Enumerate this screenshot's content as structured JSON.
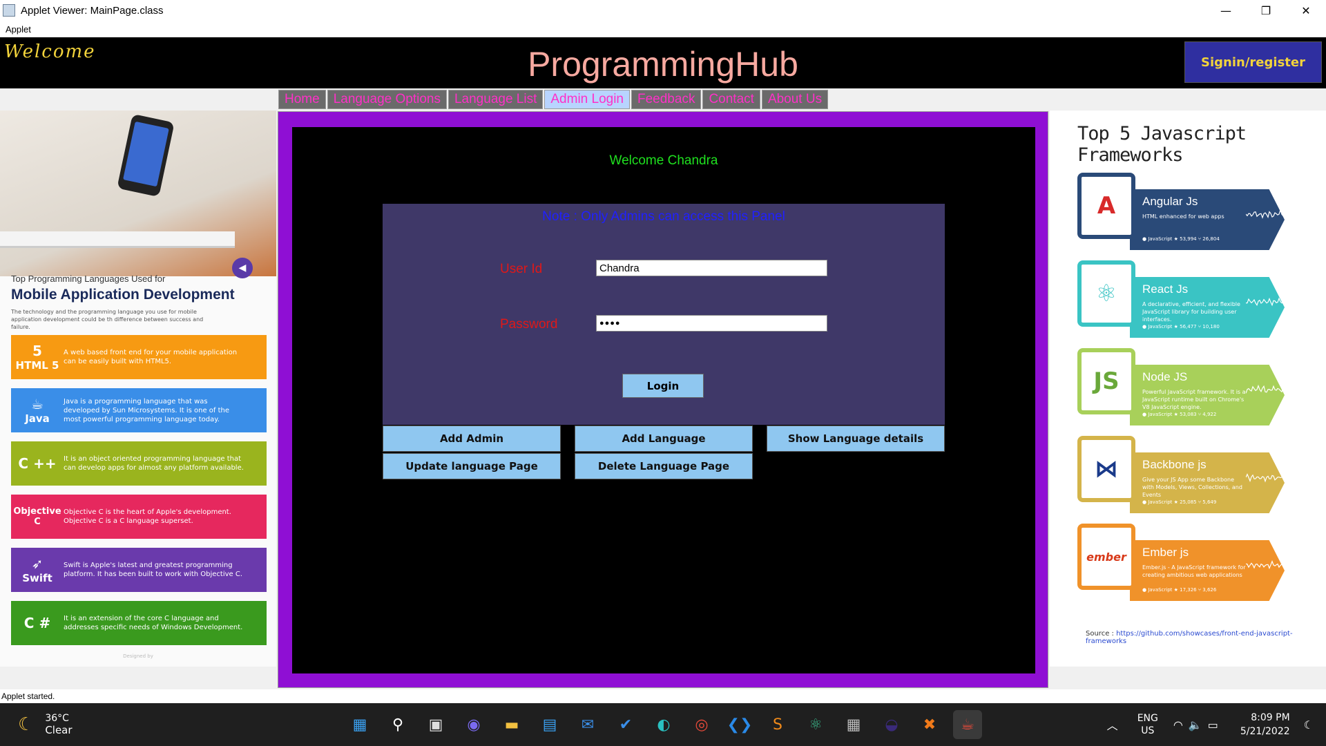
{
  "window": {
    "title": "Applet Viewer: MainPage.class",
    "menu": "Applet",
    "controls": {
      "minimize": "—",
      "restore": "❐",
      "close": "✕"
    }
  },
  "header": {
    "welcome": "Welcome",
    "brand": "ProgrammingHub",
    "signin": "Signin/register"
  },
  "tabs": [
    "Home",
    "Language Options",
    "Language List",
    "Admin Login",
    "Feedback",
    "Contact",
    "About Us"
  ],
  "active_tab": "Admin Login",
  "left_panel": {
    "subtitle": "Top Programming Languages Used for",
    "title": "Mobile Application Development",
    "description": "The technology and the programming language you use for mobile application development could be th difference between success and failure.",
    "cards": [
      {
        "name": "HTML 5",
        "icon": "html5-icon",
        "glyph": "5",
        "color": "#f79a12",
        "text": "A web based front end for your mobile application can be easily built with HTML5."
      },
      {
        "name": "Java",
        "icon": "java-icon",
        "glyph": "☕",
        "color": "#3a8ee8",
        "text": "Java is a programming language that was developed by Sun Microsystems. It is one of the most powerful programming language today."
      },
      {
        "name": "C ++",
        "icon": "cpp-icon",
        "glyph": "",
        "color": "#9ab41e",
        "text": "It is an object oriented programming language that can develop apps for almost any platform available."
      },
      {
        "name": "Objective C",
        "icon": "objc-icon",
        "glyph": "",
        "color": "#e6285e",
        "text": "Objective C is the heart of Apple's development. Objective C is a C language superset."
      },
      {
        "name": "Swift",
        "icon": "swift-icon",
        "glyph": "➶",
        "color": "#6a3aac",
        "text": "Swift is Apple's latest and greatest programming platform. It has been built to work with Objective C."
      },
      {
        "name": "C #",
        "icon": "csharp-icon",
        "glyph": "",
        "color": "#3a9a1e",
        "text": "It is an extension of the core C language and addresses specific needs of Windows Development."
      }
    ],
    "footer": "Designed by"
  },
  "admin": {
    "welcome": "Welcome Chandra",
    "note": "Note : Only Admins can access this Panel",
    "userid_label": "User Id",
    "userid_value": "Chandra",
    "password_label": "Password",
    "password_value": "●●●●",
    "login": "Login",
    "actions": [
      "Add Admin",
      "Add Language",
      "Show Language details",
      "Update language Page",
      "Delete Language Page"
    ]
  },
  "right_panel": {
    "title": "Top 5 Javascript Frameworks",
    "frameworks": [
      {
        "name": "Angular Js",
        "desc": "HTML enhanced for web apps",
        "stats": "● JavaScript   ★ 53,994   ⑂ 26,804",
        "color": "#2a4a78",
        "icon": "angular-icon",
        "glyph": "A",
        "icolor": "#d82a2a"
      },
      {
        "name": "React Js",
        "desc": "A declarative, efficient, and flexible JavaScript library for building user interfaces.",
        "stats": "● JavaScript   ★ 56,477   ⑂ 10,180",
        "color": "#3ac4c4",
        "icon": "react-icon",
        "glyph": "⚛",
        "icolor": "#3ac4c4"
      },
      {
        "name": "Node JS",
        "desc": "Powerful JavaScript framework. It is a JavaScript runtime built on Chrome's V8 JavaScript engine.",
        "stats": "● JavaScript   ★ 53,083   ⑂ 4,922",
        "color": "#a8d05a",
        "icon": "node-icon",
        "glyph": "JS",
        "icolor": "#6aa83a"
      },
      {
        "name": "Backbone js",
        "desc": "Give your JS App some Backbone with Models, Views, Collections, and Events",
        "stats": "● JavaScript   ★ 25,085   ⑂ 5,649",
        "color": "#d4b44a",
        "icon": "backbone-icon",
        "glyph": "⋈",
        "icolor": "#1a3a8a"
      },
      {
        "name": "Ember js",
        "desc": "Ember.js - A JavaScript framework for creating ambitious web applications",
        "stats": "● JavaScript   ★ 17,326   ⑂ 3,626",
        "color": "#f0922a",
        "icon": "ember-icon",
        "glyph": "ember",
        "icolor": "#d83a1a"
      }
    ],
    "source_label": "Source : ",
    "source_link": "https://github.com/showcases/front-end-javascript-frameworks"
  },
  "status": "Applet started.",
  "taskbar": {
    "temp": "36°C",
    "condition": "Clear",
    "lang1": "ENG",
    "lang2": "US",
    "time": "8:09 PM",
    "date": "5/21/2022",
    "apps": [
      {
        "icon": "windows-start-icon",
        "glyph": "▦",
        "color": "#3aa0f0"
      },
      {
        "icon": "search-icon",
        "glyph": "⚲",
        "color": "#ffffff"
      },
      {
        "icon": "task-view-icon",
        "glyph": "▣",
        "color": "#dddddd"
      },
      {
        "icon": "teams-chat-icon",
        "glyph": "◉",
        "color": "#7a6af0"
      },
      {
        "icon": "file-explorer-icon",
        "glyph": "▬",
        "color": "#f2c040"
      },
      {
        "icon": "store-icon",
        "glyph": "▤",
        "color": "#3aa0f0"
      },
      {
        "icon": "mail-icon",
        "glyph": "✉",
        "color": "#3a8ee8"
      },
      {
        "icon": "todo-icon",
        "glyph": "✔",
        "color": "#3a8ee8"
      },
      {
        "icon": "edge-icon",
        "glyph": "◐",
        "color": "#2ac0c0"
      },
      {
        "icon": "chrome-icon",
        "glyph": "◎",
        "color": "#e84a3a"
      },
      {
        "icon": "vscode-icon",
        "glyph": "❮❯",
        "color": "#2a8ae8"
      },
      {
        "icon": "sublime-icon",
        "glyph": "S",
        "color": "#f08a1a"
      },
      {
        "icon": "atom-icon",
        "glyph": "⚛",
        "color": "#3ab88a"
      },
      {
        "icon": "calculator-icon",
        "glyph": "▦",
        "color": "#bbbbbb"
      },
      {
        "icon": "eclipse-icon",
        "glyph": "◒",
        "color": "#3a2a7a"
      },
      {
        "icon": "xampp-icon",
        "glyph": "✖",
        "color": "#f07a1a"
      },
      {
        "icon": "java-icon",
        "glyph": "☕",
        "color": "#e84a3a"
      }
    ]
  }
}
